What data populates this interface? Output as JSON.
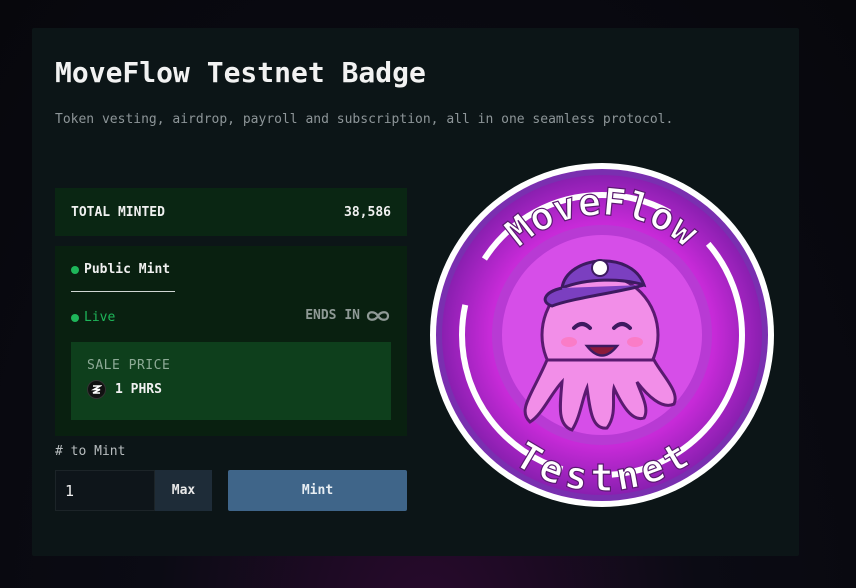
{
  "header": {
    "title": "MoveFlow Testnet Badge",
    "subtitle": "Token vesting, airdrop, payroll and subscription, all in one seamless protocol."
  },
  "stats": {
    "total_label": "TOTAL MINTED",
    "total_value": "38,586"
  },
  "mint_panel": {
    "tab_label": "Public Mint",
    "status": "Live",
    "ends_label": "ENDS IN",
    "ends_icon": "infinity-icon",
    "sale_price_label": "SALE PRICE",
    "sale_price_value": "1 PHRS",
    "token_icon": "phrs-token-icon"
  },
  "quantity": {
    "label": "# to Mint",
    "value": "1",
    "max_label": "Max"
  },
  "actions": {
    "mint_label": "Mint"
  },
  "badge": {
    "top_text": "MoveFlow",
    "bottom_text": "Testnet"
  },
  "colors": {
    "card_bg": "#0c1517",
    "green_status": "#1eb65a",
    "mint_button": "#3f6589",
    "badge_magenta": "#d62fe6",
    "badge_purple": "#7a2fb0"
  }
}
